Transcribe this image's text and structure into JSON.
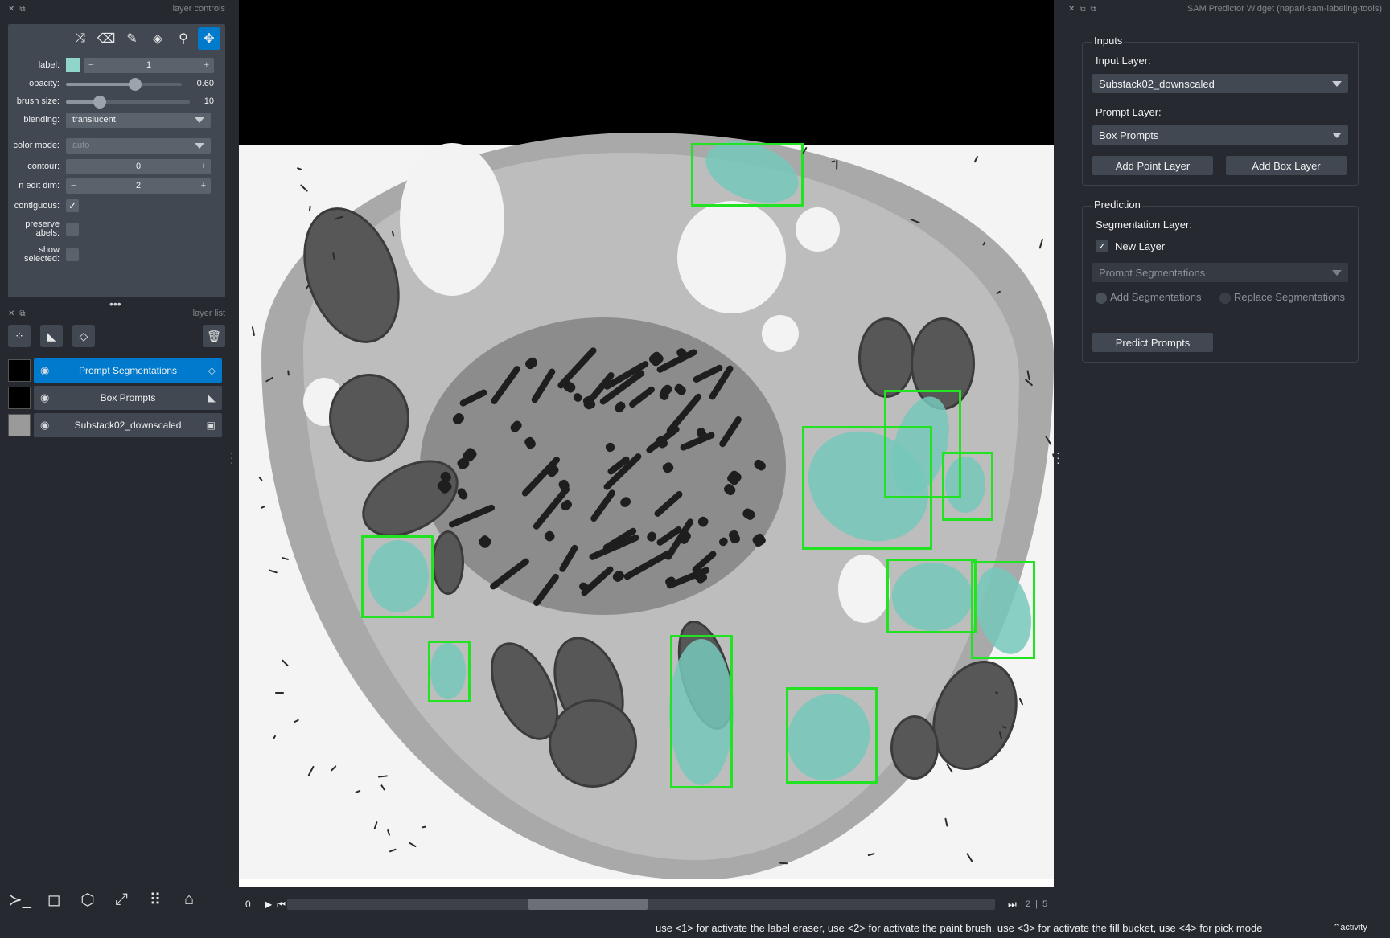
{
  "left_dock": {
    "controls_title": "layer controls",
    "list_title": "layer list",
    "label": {
      "label": "label:",
      "value": "1",
      "swatch_color": "#8fd6c8"
    },
    "opacity": {
      "label": "opacity:",
      "value": "0.60",
      "fraction": 0.6
    },
    "brush_size": {
      "label": "brush size:",
      "value": "10",
      "fraction": 0.27
    },
    "blending": {
      "label": "blending:",
      "value": "translucent"
    },
    "color_mode": {
      "label": "color mode:",
      "value": "auto"
    },
    "contour": {
      "label": "contour:",
      "value": "0"
    },
    "n_edit_dim": {
      "label": "n edit dim:",
      "value": "2"
    },
    "contiguous": {
      "label": "contiguous:",
      "checked": true
    },
    "preserve_labels": {
      "label": "preserve labels:",
      "checked": false
    },
    "show_selected": {
      "label": "show selected:",
      "checked": false
    },
    "tools": [
      "shuffle-icon",
      "eraser-icon",
      "brush-icon",
      "fill-icon",
      "picker-icon",
      "move-icon"
    ],
    "layers": [
      {
        "name": "Prompt Segmentations",
        "selected": true,
        "type_icon": "labels-icon"
      },
      {
        "name": "Box Prompts",
        "selected": false,
        "type_icon": "shapes-icon"
      },
      {
        "name": "Substack02_downscaled",
        "selected": false,
        "type_icon": "image-icon"
      }
    ]
  },
  "canvas": {
    "frame_index": "0",
    "frame_counter": "2",
    "frame_total": "5"
  },
  "right_dock": {
    "title": "SAM Predictor Widget (napari-sam-labeling-tools)",
    "inputs_title": "Inputs",
    "input_layer_label": "Input Layer:",
    "input_layer_value": "Substack02_downscaled",
    "prompt_layer_label": "Prompt Layer:",
    "prompt_layer_value": "Box Prompts",
    "add_point_layer": "Add Point Layer",
    "add_box_layer": "Add Box Layer",
    "prediction_title": "Prediction",
    "segmentation_layer_label": "Segmentation Layer:",
    "new_layer_label": "New Layer",
    "new_layer_checked": true,
    "seg_dropdown_value": "Prompt Segmentations",
    "add_segmentations": "Add Segmentations",
    "replace_segmentations": "Replace Segmentations",
    "predict_prompts": "Predict Prompts"
  },
  "status": {
    "message": "use <1> for activate the label eraser, use <2> for activate the paint brush, use <3> for activate the fill bucket, use <4> for pick mode",
    "activity": "activity"
  }
}
